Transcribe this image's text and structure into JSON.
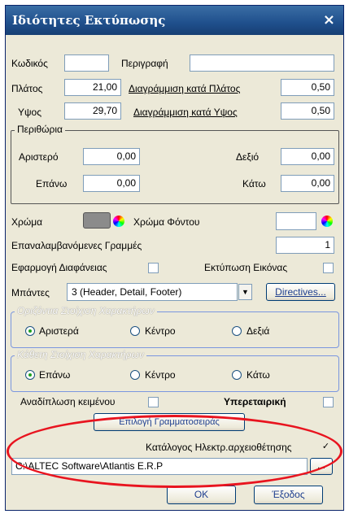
{
  "window": {
    "title": "Ιδιότητες Εκτύπωσης",
    "close_glyph": "×"
  },
  "fields": {
    "code_label": "Κωδικός",
    "code_value": "",
    "description_label": "Περιγραφή",
    "description_value": "",
    "width_label": "Πλάτος",
    "width_value": "21,00",
    "width_ruling_label": "Διαγράμμιση κατά Πλάτος",
    "width_ruling_value": "0,50",
    "height_label": "Υψος",
    "height_value": "29,70",
    "height_ruling_label": "Διαγράμμιση κατά Υψος",
    "height_ruling_value": "0,50"
  },
  "margins": {
    "title": "Περιθώρια",
    "left_label": "Αριστερό",
    "left_value": "0,00",
    "right_label": "Δεξιό",
    "right_value": "0,00",
    "top_label": "Επάνω",
    "top_value": "0,00",
    "bottom_label": "Κάτω",
    "bottom_value": "0,00"
  },
  "colors": {
    "color_label": "Χρώμα",
    "color_swatch": "#8b8b8b",
    "background_label": "Χρώμα Φόντου",
    "background_swatch": "#ffffff",
    "wheel_icon": "color-picker-icon"
  },
  "repeated_lines_label": "Επαναλαμβανόμενες Γραμμές",
  "repeated_lines_value": "1",
  "transparency_label": "Εφαρμογή Διαφάνειας",
  "transparency_checked": false,
  "print_image_label": "Εκτύπωση Εικόνας",
  "print_image_checked": false,
  "sections_label": "Μπάντες",
  "sections_value": "3  (Header, Detail, Footer)",
  "directives_button": "Directives...",
  "horizontal_align": {
    "title": "Οριζόντια Στοίχιση Χαρακτήρων",
    "options": [
      "Αριστερά",
      "Κέντρο",
      "Δεξιά"
    ],
    "selected": "Αριστερά"
  },
  "vertical_align": {
    "title": "Κάθετη Στοίχιση Χαρακτήρων",
    "options": [
      "Επάνω",
      "Κέντρο",
      "Κάτω"
    ],
    "selected": "Επάνω"
  },
  "word_wrap_label": "Αναδίπλωση κειμένου",
  "word_wrap_checked": false,
  "superscript_label": "Υπερεταιρική",
  "superscript_checked": false,
  "font_button": "Επιλογή Γραμματοσειράς",
  "archive_label": "Κατάλογος Ηλεκτρ.αρχειοθέτησης",
  "archive_checked": true,
  "archive_path": "C:\\ALTEC Software\\Atlantis E.R.P",
  "browse_button": "...",
  "ok_button": "OK",
  "exit_button": "Έξοδος",
  "accent_colors": {
    "title_bar": "#1f4f8c",
    "annotation_ring": "#e8141f"
  }
}
